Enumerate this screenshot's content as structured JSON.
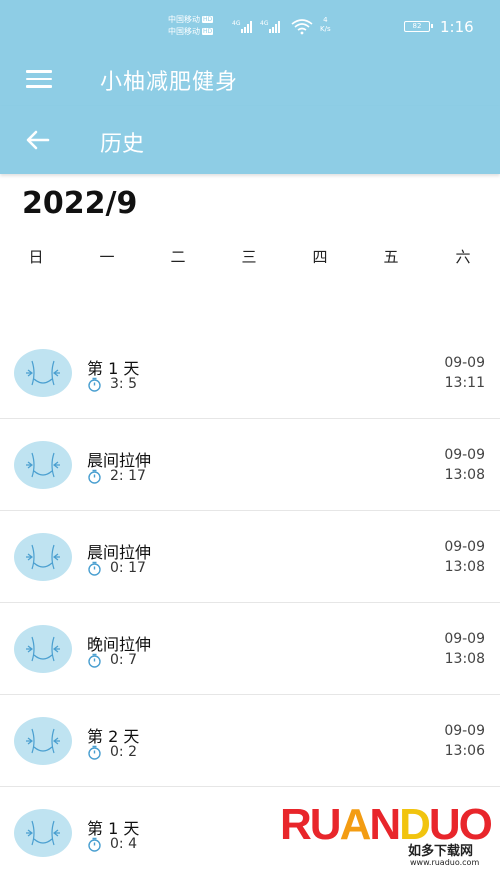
{
  "status_bar": {
    "carrier_1": "中国移动",
    "carrier_2": "中国移动",
    "hd_tag": "HD",
    "speed_value": "4",
    "speed_unit": "K/s",
    "battery": "82",
    "time": "1:16"
  },
  "app_bar": {
    "title": "小柚减肥健身",
    "menu_icon": "hamburger-menu-icon"
  },
  "sub_bar": {
    "title": "历史",
    "back_icon": "arrow-left-icon"
  },
  "calendar": {
    "month": "2022/9",
    "weekdays": [
      "日",
      "一",
      "二",
      "三",
      "四",
      "五",
      "六"
    ]
  },
  "history": [
    {
      "name": "第 1 天",
      "duration": "3: 5",
      "date": "09-09",
      "time": "13:11"
    },
    {
      "name": "晨间拉伸",
      "duration": "2: 17",
      "date": "09-09",
      "time": "13:08"
    },
    {
      "name": "晨间拉伸",
      "duration": "0: 17",
      "date": "09-09",
      "time": "13:08"
    },
    {
      "name": "晚间拉伸",
      "duration": "0: 7",
      "date": "09-09",
      "time": "13:08"
    },
    {
      "name": "第 2 天",
      "duration": "0: 2",
      "date": "09-09",
      "time": "13:06"
    },
    {
      "name": "第 1 天",
      "duration": "0: 4",
      "date": "",
      "time": ""
    }
  ],
  "watermark": {
    "logo_text": "RUANDUO",
    "subtitle": "如多下载网",
    "url": "www.ruaduo.com"
  },
  "colors": {
    "header": "#8ecde5",
    "avatar_bg": "#bfe3f1",
    "icon_blue": "#4a9fd0"
  }
}
